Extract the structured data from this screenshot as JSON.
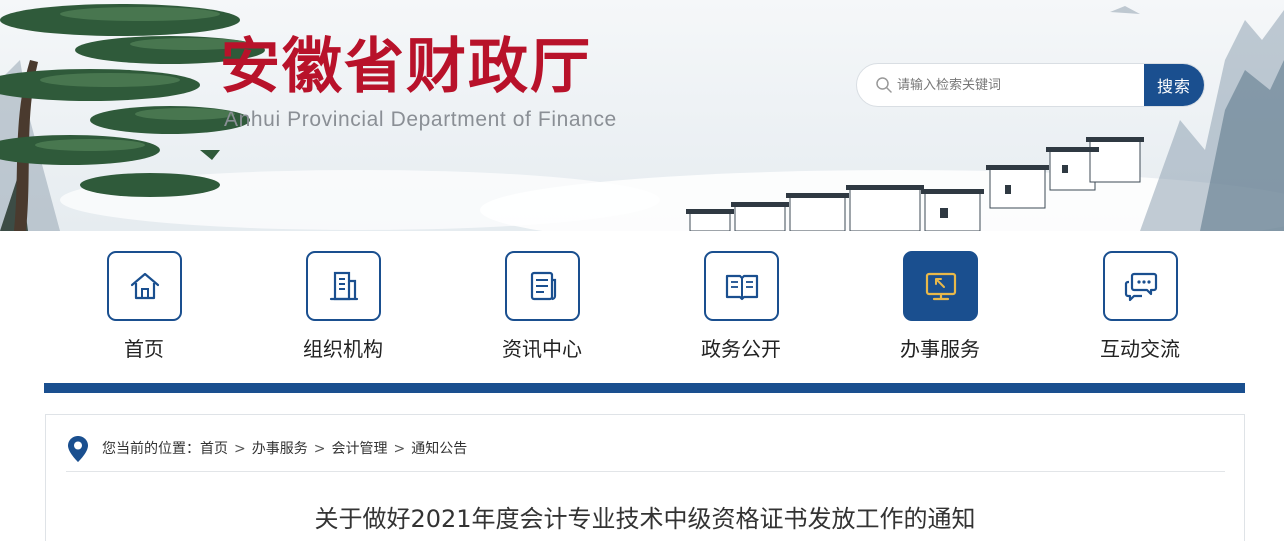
{
  "header": {
    "logo_cn": "安徽省财政厅",
    "logo_en": "Anhui Provincial Department of Finance",
    "search": {
      "placeholder": "请输入检索关键词",
      "button_label": "搜索"
    }
  },
  "nav": {
    "items": [
      {
        "label": "首页",
        "icon": "home-icon",
        "active": false
      },
      {
        "label": "组织机构",
        "icon": "building-icon",
        "active": false
      },
      {
        "label": "资讯中心",
        "icon": "news-icon",
        "active": false
      },
      {
        "label": "政务公开",
        "icon": "open-book-icon",
        "active": false
      },
      {
        "label": "办事服务",
        "icon": "monitor-icon",
        "active": true
      },
      {
        "label": "互动交流",
        "icon": "chat-bubbles-icon",
        "active": false
      }
    ]
  },
  "breadcrumb": {
    "prefix": "您当前的位置：",
    "separator": ">",
    "items": [
      "首页",
      "办事服务",
      "会计管理",
      "通知公告"
    ]
  },
  "article": {
    "title": "关于做好2021年度会计专业技术中级资格证书发放工作的通知"
  },
  "colors": {
    "brand_red": "#b8122a",
    "primary_blue": "#1a4f8f",
    "active_icon_accent": "#e8b84a"
  }
}
